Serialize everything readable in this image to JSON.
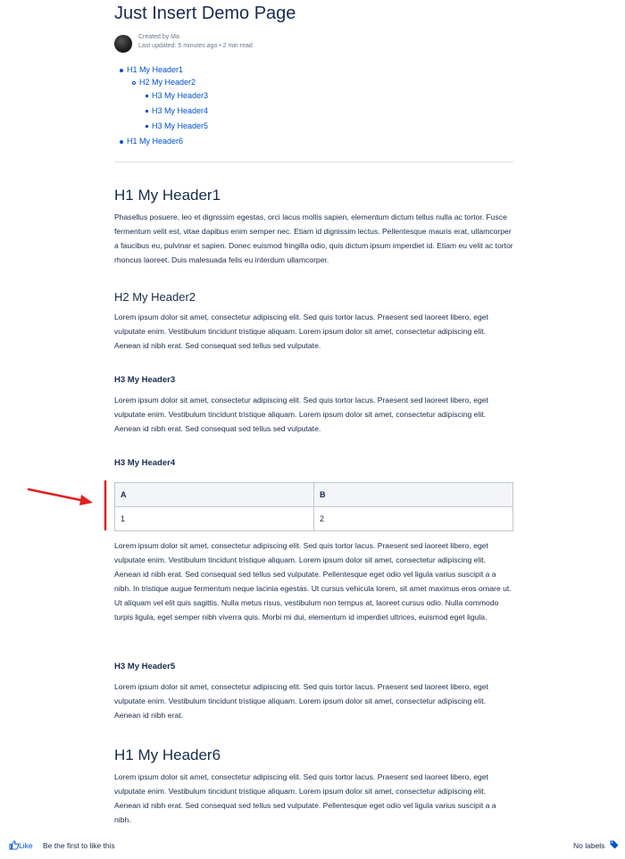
{
  "page": {
    "title": "Just Insert Demo Page",
    "created_by": "Created by Ma",
    "last_updated": "Last updated: 5 minutes ago  •  2 min read"
  },
  "toc": [
    {
      "level": 1,
      "label": "H1 My Header1"
    },
    {
      "level": 2,
      "label": "H2 My Header2"
    },
    {
      "level": 3,
      "label": "H3 My Header3"
    },
    {
      "level": 3,
      "label": "H3 My Header4"
    },
    {
      "level": 3,
      "label": "H3 My Header5"
    },
    {
      "level": 1,
      "label": "H1 My Header6"
    }
  ],
  "sections": {
    "h1_header1": {
      "heading": "H1 My Header1",
      "text": "Phasellus posuere, leo et dignissim egestas, orci lacus mollis sapien, elementum dictum tellus nulla ac tortor. Fusce fermentum velit est, vitae dapibus enim semper nec. Etiam id dignissim lectus. Pellentesque mauris erat, ullamcorper a faucibus eu, pulvinar et sapien. Donec euismod fringilla odio, quis dictum ipsum imperdiet id. Etiam eu velit ac tortor rhoncus laoreet. Duis malesuada felis eu interdum ullamcorper."
    },
    "h2_header2": {
      "heading": "H2 My Header2",
      "text": "Lorem ipsum dolor sit amet, consectetur adipiscing elit. Sed quis tortor lacus. Praesent sed laoreet libero, eget vulputate enim. Vestibulum tincidunt tristique aliquam. Lorem ipsum dolor sit amet, consectetur adipiscing elit. Aenean id nibh erat. Sed consequat sed tellus sed vulputate."
    },
    "h3_header3": {
      "heading": "H3 My Header3",
      "text": "Lorem ipsum dolor sit amet, consectetur adipiscing elit. Sed quis tortor lacus. Praesent sed laoreet libero, eget vulputate enim. Vestibulum tincidunt tristique aliquam. Lorem ipsum dolor sit amet, consectetur adipiscing elit. Aenean id nibh erat. Sed consequat sed tellus sed vulputate."
    },
    "h3_header4": {
      "heading": "H3 My Header4",
      "table": {
        "headers": [
          "A",
          "B"
        ],
        "rows": [
          [
            "1",
            "2"
          ]
        ]
      },
      "text": "Lorem ipsum dolor sit amet, consectetur adipiscing elit. Sed quis tortor lacus. Praesent sed laoreet libero, eget vulputate enim. Vestibulum tincidunt tristique aliquam. Lorem ipsum dolor sit amet, consectetur adipiscing elit. Aenean id nibh erat. Sed consequat sed tellus sed vulputate. Pellentesque eget odio vel ligula varius suscipit a a nibh. In tristique augue fermentum neque lacinia egestas. Ut cursus vehicula lorem, sit amet maximus eros ornare ut. Ut aliquam vel elit quis sagittis. Nulla metus risus, vestibulum non tempus at, laoreet cursus odio. Nulla commodo turpis ligula, eget semper nibh viverra quis. Morbi mi dui, elementum id imperdiet ultrices, euismod eget ligula."
    },
    "h3_header5": {
      "heading": "H3 My Header5",
      "text": "Lorem ipsum dolor sit amet, consectetur adipiscing elit. Sed quis tortor lacus. Praesent sed laoreet libero, eget vulputate enim. Vestibulum tincidunt tristique aliquam. Lorem ipsum dolor sit amet, consectetur adipiscing elit. Aenean id nibh erat."
    },
    "h1_header6": {
      "heading": "H1 My Header6",
      "text": "Lorem ipsum dolor sit amet, consectetur adipiscing elit. Sed quis tortor lacus. Praesent sed laoreet libero, eget vulputate enim. Vestibulum tincidunt tristique aliquam. Lorem ipsum dolor sit amet, consectetur adipiscing elit. Aenean id nibh erat. Sed consequat sed tellus sed vulputate. Pellentesque eget odio vel ligula varius suscipit a a nibh."
    }
  },
  "footer": {
    "like_label": "Like",
    "like_prompt": "Be the first to like this",
    "labels_text": "No labels"
  },
  "colors": {
    "link": "#0052cc",
    "text": "#172b4d",
    "annotation": "#e02020"
  },
  "icons": [
    "avatar",
    "thumbs-up-icon",
    "tag-icon",
    "annotation-arrow",
    "annotation-line"
  ]
}
